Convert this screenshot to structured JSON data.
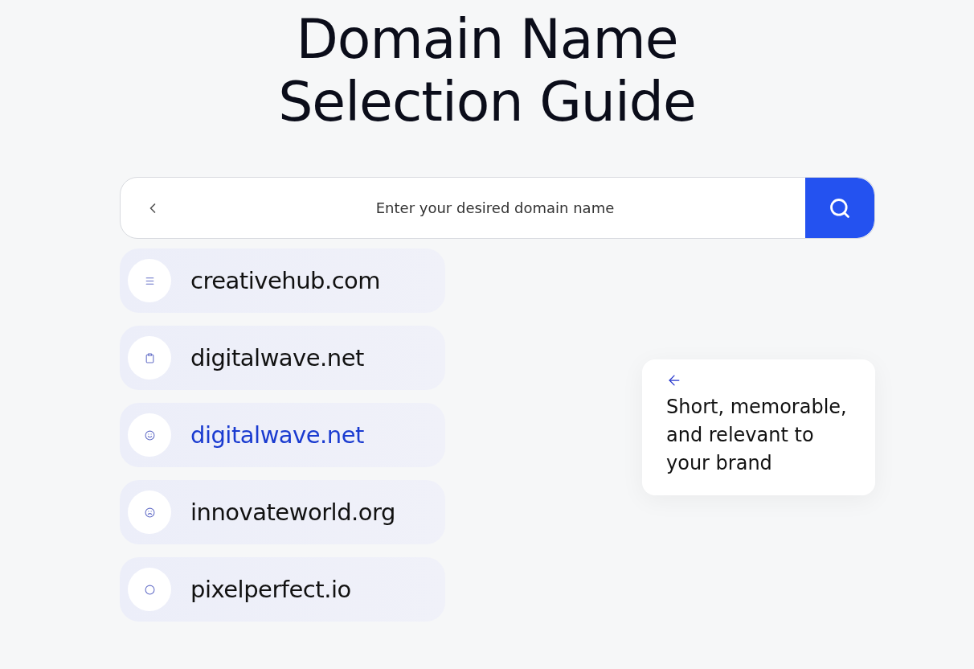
{
  "title": "Domain Name Selection Guide",
  "search": {
    "placeholder": "Enter your desired domain name"
  },
  "suggestions": [
    {
      "label": "creativehub.com",
      "selected": false
    },
    {
      "label": "digitalwave.net",
      "selected": false
    },
    {
      "label": "digitalwave.net",
      "selected": true
    },
    {
      "label": "innovateworld.org",
      "selected": false
    },
    {
      "label": "pixelperfect.io",
      "selected": false
    }
  ],
  "tip": {
    "text": "Short, memorable, and relevant to your brand"
  }
}
